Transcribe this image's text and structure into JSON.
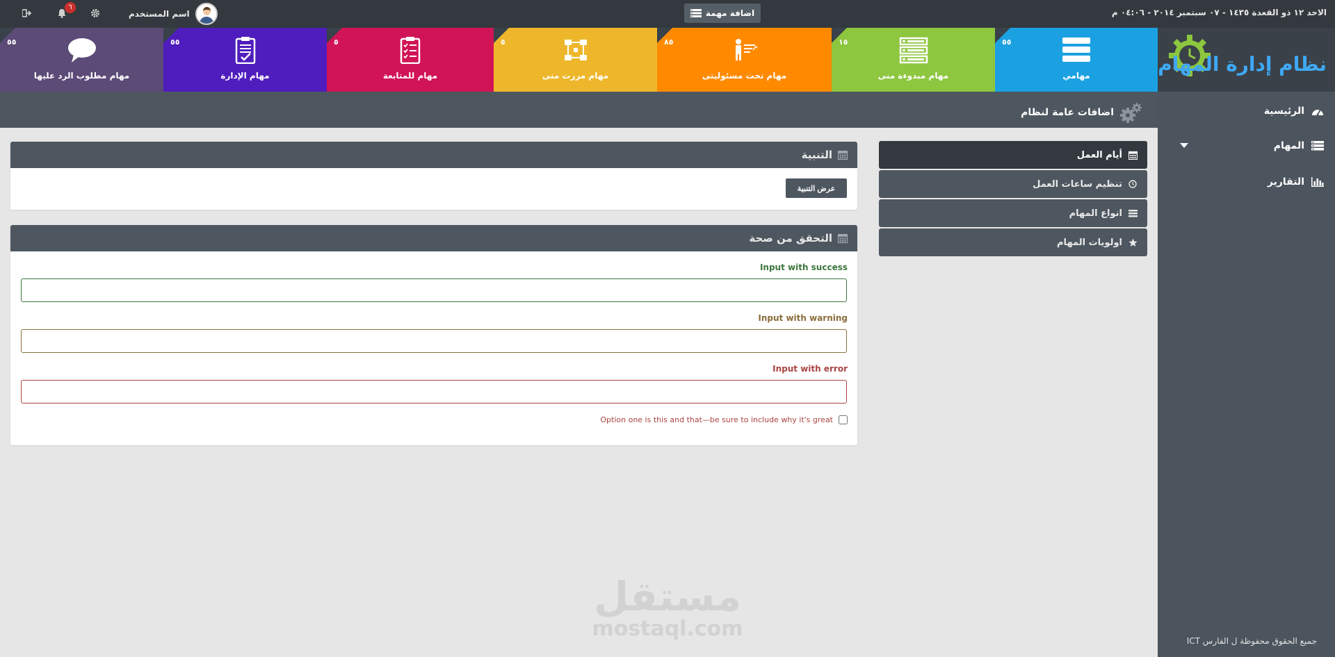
{
  "topbar": {
    "date": "الاحد ١٢ ذو القعدة ١٤٣٥ - ٠٧ سبتمبر ٢٠١٤ - ٠٤:٠٦ م",
    "add_task_label": "اضافة مهمة",
    "user_name": "اسم المستخدم",
    "notification_count": "٦"
  },
  "logo": {
    "title": "نظام إدارة المهام"
  },
  "tiles": [
    {
      "label": "مهامي",
      "count": "٥٥",
      "color": "#1ba1e2",
      "icon": "server-icon"
    },
    {
      "label": "مهام مبدوءة منى",
      "count": "١٥",
      "color": "#8dc63f",
      "icon": "list-icon"
    },
    {
      "label": "مهام تحت مسئوليتى",
      "count": "٨٥",
      "color": "#ff8a00",
      "icon": "presenter-icon"
    },
    {
      "label": "مهام مررت منى",
      "count": "٥",
      "color": "#eeb72b",
      "icon": "flow-icon"
    },
    {
      "label": "مهام للمتابعة",
      "count": "٥",
      "color": "#d11456",
      "icon": "checklist-icon"
    },
    {
      "label": "مهام الإدارة",
      "count": "٥٥",
      "color": "#4f1dbd",
      "icon": "clipboard-icon"
    },
    {
      "label": "مهام مطلوب الرد عليها",
      "count": "٥٥",
      "color": "#5c4a77",
      "icon": "speech-bubble-icon"
    }
  ],
  "sidebar": {
    "items": [
      {
        "label": "الرئيسية",
        "icon": "dashboard-icon"
      },
      {
        "label": "المهام",
        "icon": "list-icon"
      },
      {
        "label": "التقارير",
        "icon": "bar-chart-icon"
      }
    ],
    "copyright": "جميع الحقوق محفوظة ل الفارس ICT"
  },
  "page": {
    "title": "اضافات عامة لنظام"
  },
  "settings_menu": {
    "items": [
      {
        "label": "أيام العمل",
        "icon": "calendar-icon"
      },
      {
        "label": "تنظيم ساعات العمل",
        "icon": "clock-icon"
      },
      {
        "label": "انواع المهام",
        "icon": "list-icon"
      },
      {
        "label": "اولويات المهام",
        "icon": "star-icon"
      }
    ]
  },
  "alert_panel": {
    "title": "التنبية",
    "button_label": "عرض التنبية"
  },
  "validation_panel": {
    "title": "التحقق من صحة",
    "success_label": "Input with success",
    "warning_label": "Input with warning",
    "error_label": "Input with error",
    "checkbox_label": "Option one is this and that—be sure to include why it's great"
  },
  "colors": {
    "success": "#3c763d",
    "warning": "#8a6d3b",
    "error": "#a94442",
    "logo_green": "#8dc63f",
    "logo_blue": "#3fa9f5"
  },
  "watermark": {
    "arabic": "مستقل",
    "latin": "mostaql.com"
  }
}
